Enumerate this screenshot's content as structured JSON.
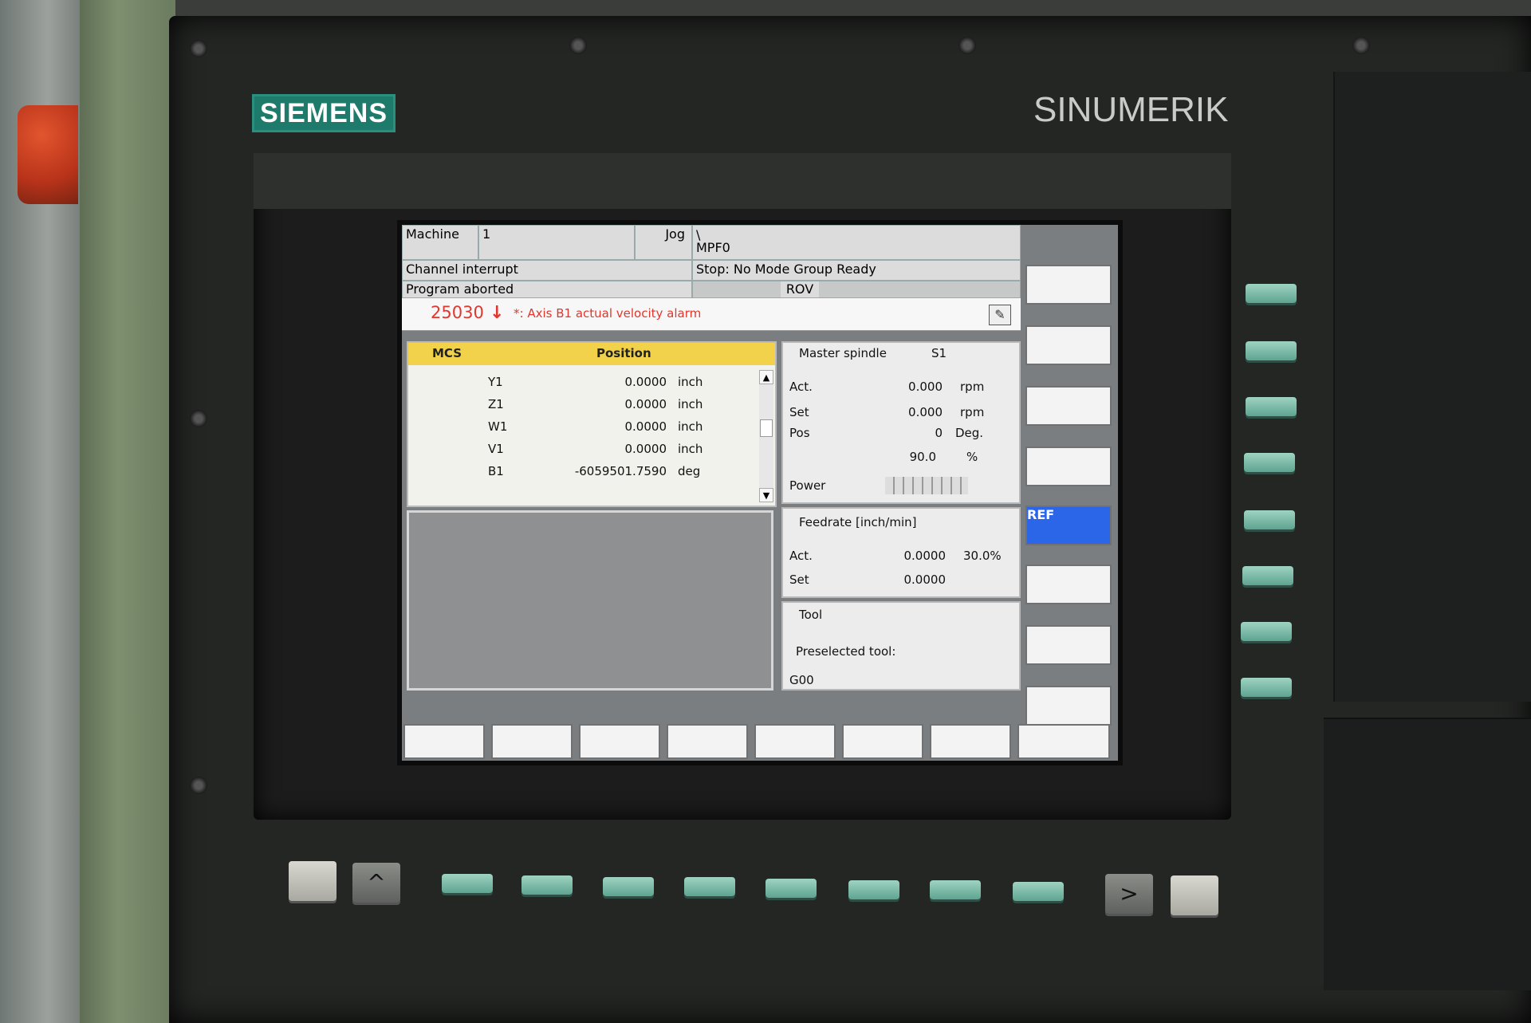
{
  "brand": {
    "siemens": "SIEMENS",
    "sinumerik": "SINUMERIK"
  },
  "header": {
    "area": "Machine",
    "channel": "1",
    "mode": "Jog",
    "path_line1": "\\",
    "program": "MPF0",
    "status_left_1": "Channel interrupt",
    "status_right_1": "Stop: No Mode Group Ready",
    "status_left_2": "Program aborted",
    "status_right_2": "ROV"
  },
  "alarm": {
    "number": "25030",
    "arrow": "↓",
    "text": "*: Axis B1 actual velocity alarm",
    "edit_icon": "pencil-icon"
  },
  "mcs": {
    "col1": "MCS",
    "col2": "Position",
    "axes": [
      {
        "name": "Y1",
        "value": "0.0000",
        "unit": "inch"
      },
      {
        "name": "Z1",
        "value": "0.0000",
        "unit": "inch"
      },
      {
        "name": "W1",
        "value": "0.0000",
        "unit": "inch"
      },
      {
        "name": "V1",
        "value": "0.0000",
        "unit": "inch"
      },
      {
        "name": "B1",
        "value": "-6059501.7590",
        "unit": "deg"
      }
    ]
  },
  "spindle": {
    "title": "Master spindle",
    "id": "S1",
    "act_label": "Act.",
    "act_value": "0.000",
    "act_unit": "rpm",
    "set_label": "Set",
    "set_value": "0.000",
    "set_unit": "rpm",
    "pos_label": "Pos",
    "pos_value": "0",
    "pos_unit": "Deg.",
    "override_value": "90.0",
    "override_unit": "%",
    "power_label": "Power"
  },
  "feed": {
    "title": "Feedrate [inch/min]",
    "act_label": "Act.",
    "act_value": "0.0000",
    "act_override": "30.0%",
    "set_label": "Set",
    "set_value": "0.0000"
  },
  "tool": {
    "title": "Tool",
    "preselected_label": "Preselected tool:",
    "gcode": "G00"
  },
  "softkeys": {
    "vertical": [
      "",
      "",
      "",
      "",
      "REF",
      "",
      "",
      ""
    ],
    "horizontal": [
      "",
      "",
      "",
      "",
      "",
      "",
      "",
      ""
    ]
  },
  "colors": {
    "alarm": "#e0372e",
    "mcs_header": "#f2d24a",
    "ref_key": "#2c66e8",
    "keycap": "#6fb5a0"
  }
}
